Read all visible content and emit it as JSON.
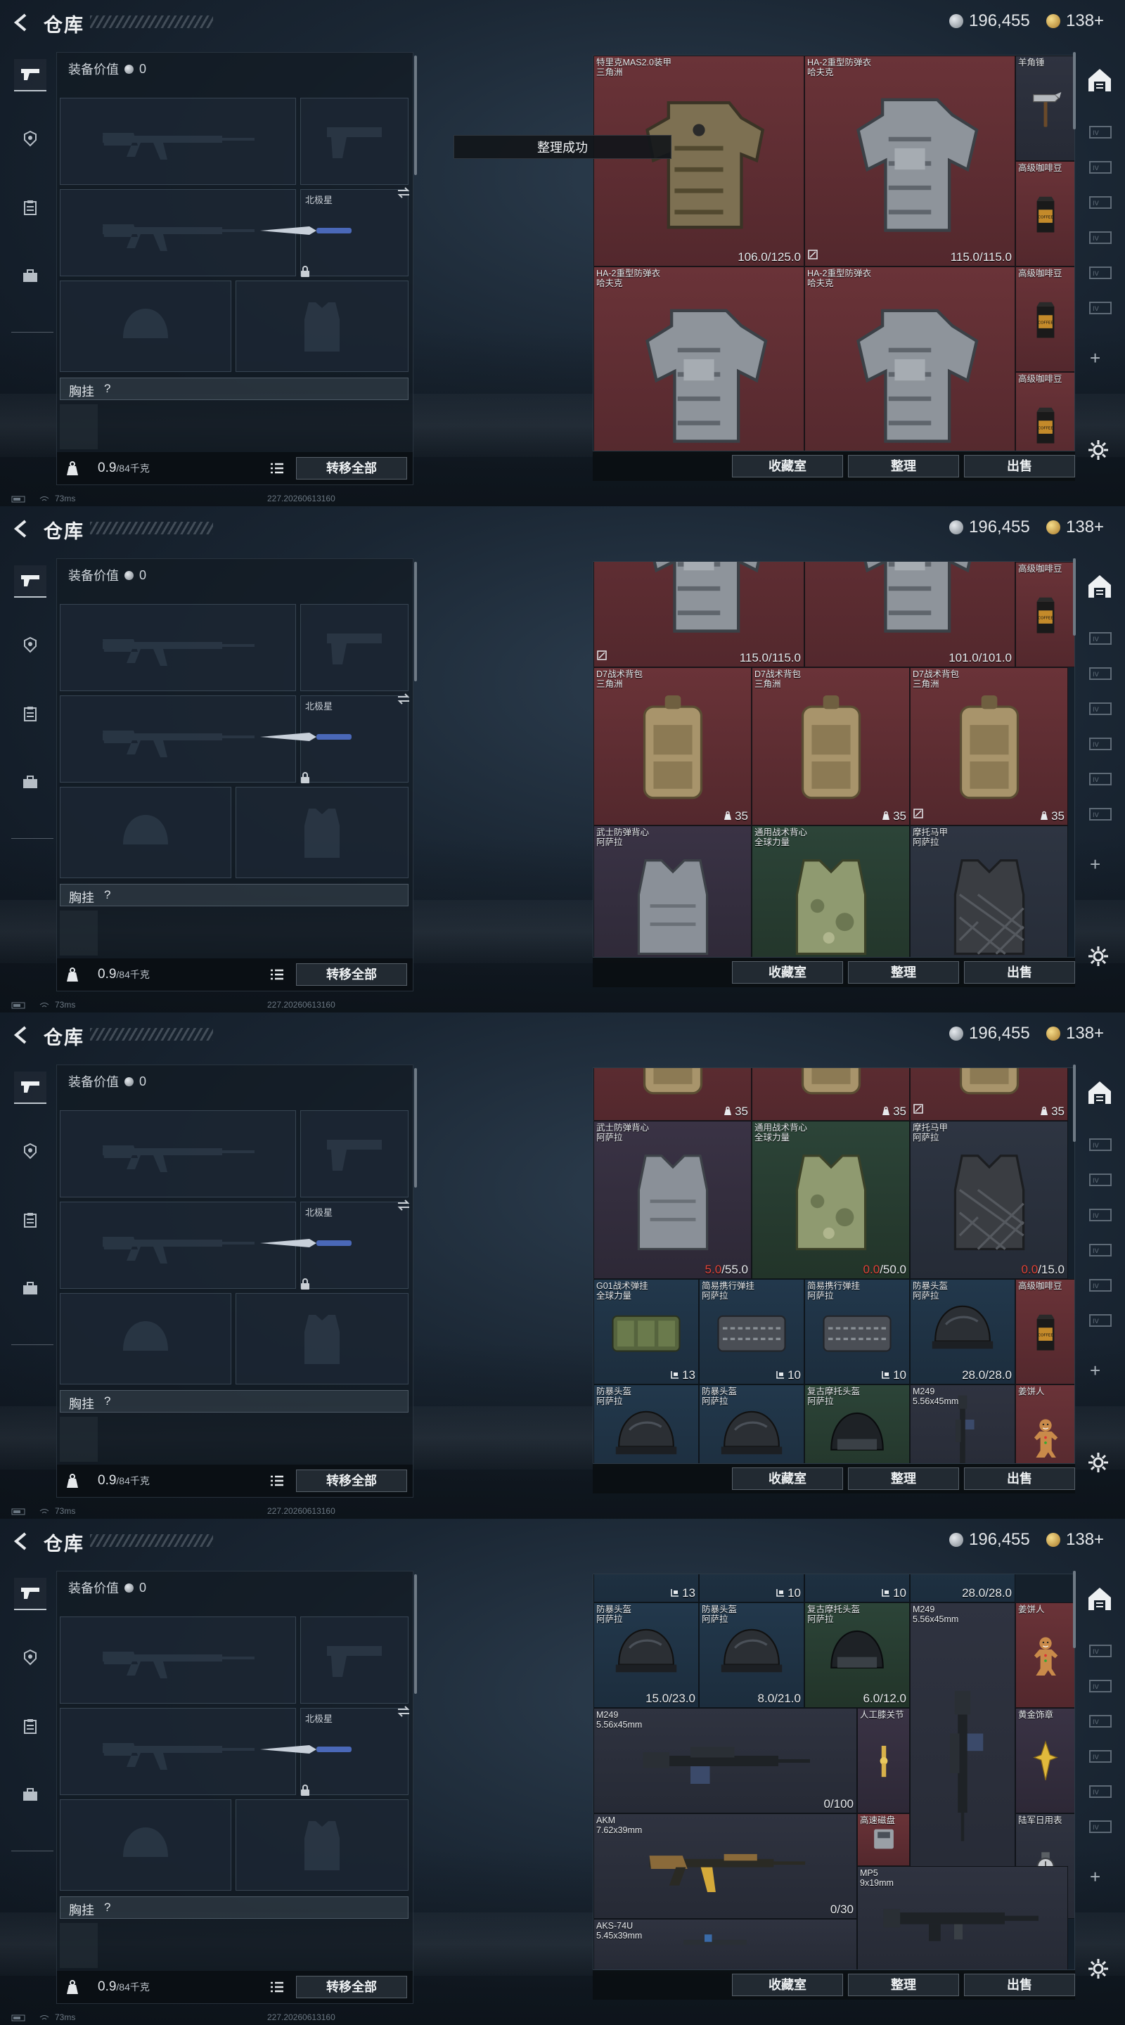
{
  "header": {
    "title": "仓库",
    "silver_amount": "196,455",
    "gold_amount": "138+"
  },
  "equipment": {
    "value_label": "装备价值",
    "value": "0",
    "secondary_weapon_label": "北极星",
    "chest_rig_label": "胸挂",
    "chest_rig_help": "?",
    "weight_current": "0.9",
    "weight_max": "/84千克",
    "transfer_all_label": "转移全部"
  },
  "stash_buttons": {
    "collection_label": "收藏室",
    "sort_label": "整理",
    "sell_label": "出售"
  },
  "toast": "整理成功",
  "status": {
    "ping": "73ms",
    "build": "227.20260613160"
  },
  "stash_items": [
    {
      "name": "特里克MAS2.0装甲",
      "sub": "三角洲",
      "value": "106.0/125.0",
      "color": "red",
      "art": "armor-tan"
    },
    {
      "name": "HA-2重型防弹衣",
      "sub": "哈夫克",
      "value": "115.0/115.0",
      "color": "red",
      "art": "armor-gray",
      "icon": "repair"
    },
    {
      "name": "羊角锤",
      "sub": "",
      "value": "",
      "color": "dark",
      "art": "hammer"
    },
    {
      "name": "高级咖啡豆",
      "sub": "",
      "value": "",
      "color": "red",
      "art": "coffee"
    },
    {
      "name": "HA-2重型防弹衣",
      "sub": "哈夫克",
      "value": "115.0/115.0",
      "color": "red",
      "art": "armor-gray",
      "icon": "repair"
    },
    {
      "name": "HA-2重型防弹衣",
      "sub": "哈夫克",
      "value": "101.0/101.0",
      "color": "red",
      "art": "armor-gray"
    },
    {
      "name": "高级咖啡豆",
      "sub": "",
      "value": "",
      "color": "red",
      "art": "coffee"
    },
    {
      "name": "高级咖啡豆",
      "sub": "",
      "value": "",
      "color": "red",
      "art": "coffee"
    },
    {
      "name": "D7战术背包",
      "sub": "三角洲",
      "value": "35",
      "color": "red",
      "art": "backpack",
      "valicon": "weight"
    },
    {
      "name": "D7战术背包",
      "sub": "三角洲",
      "value": "35",
      "color": "red",
      "art": "backpack",
      "valicon": "weight"
    },
    {
      "name": "D7战术背包",
      "sub": "三角洲",
      "value": "35",
      "color": "red",
      "art": "backpack",
      "valicon": "weight",
      "icon": "repair"
    },
    {
      "name": "高级咖啡豆",
      "sub": "",
      "value": "",
      "color": "red",
      "art": "coffee"
    },
    {
      "name": "武士防弹背心",
      "sub": "阿萨拉",
      "value_low": "5.0",
      "value": "/55.0",
      "color": "purple",
      "art": "vest-gray"
    },
    {
      "name": "通用战术背心",
      "sub": "全球力量",
      "value_low": "0.0",
      "value": "/50.0",
      "color": "green",
      "art": "vest-camo"
    },
    {
      "name": "摩托马甲",
      "sub": "阿萨拉",
      "value_low": "0.0",
      "value": "/15.0",
      "color": "slate",
      "art": "vest-quilt"
    },
    {
      "name": "G01战术弹挂",
      "sub": "全球力量",
      "value": "13",
      "color": "blue",
      "art": "rig-green",
      "valicon": "slots"
    },
    {
      "name": "简易携行弹挂",
      "sub": "阿萨拉",
      "value": "10",
      "color": "blue",
      "art": "rig-gray",
      "valicon": "slots"
    },
    {
      "name": "简易携行弹挂",
      "sub": "阿萨拉",
      "value": "10",
      "color": "blue",
      "art": "rig-gray",
      "valicon": "slots"
    },
    {
      "name": "防暴头盔",
      "sub": "阿萨拉",
      "value": "28.0/28.0",
      "color": "blue",
      "art": "helmet"
    },
    {
      "name": "高级咖啡豆",
      "sub": "",
      "value": "",
      "color": "red",
      "art": "coffee"
    },
    {
      "name": "防暴头盔",
      "sub": "阿萨拉",
      "value": "15.0/23.0",
      "color": "blue",
      "art": "helmet"
    },
    {
      "name": "防暴头盔",
      "sub": "阿萨拉",
      "value": "8.0/21.0",
      "color": "blue",
      "art": "helmet"
    },
    {
      "name": "复古摩托头盔",
      "sub": "阿萨拉",
      "value": "6.0/12.0",
      "color": "green",
      "art": "helmet-moto"
    },
    {
      "name": "M249",
      "sub": "5.56x45mm",
      "value": "0/100",
      "color": "dark",
      "art": "m249-v"
    },
    {
      "name": "姜饼人",
      "sub": "",
      "value": "",
      "color": "red",
      "art": "gingerbread"
    },
    {
      "name": "M249",
      "sub": "5.56x45mm",
      "value": "0/100",
      "color": "dark",
      "art": "m249-h"
    },
    {
      "name": "人工膝关节",
      "sub": "",
      "value": "",
      "color": "purple",
      "art": "knee"
    },
    {
      "name": "黄金饰章",
      "sub": "",
      "value": "",
      "color": "purple",
      "art": "emblem"
    },
    {
      "name": "AKM",
      "sub": "7.62x39mm",
      "value": "0/30",
      "color": "dark",
      "art": "akm"
    },
    {
      "name": "高速磁盘",
      "sub": "",
      "value": "",
      "color": "red",
      "art": "disk"
    },
    {
      "name": "MP5",
      "sub": "9x19mm",
      "value": "",
      "color": "dark",
      "art": "mp5"
    },
    {
      "name": "陆军日用表",
      "sub": "",
      "value": "",
      "color": "dark",
      "art": "watch"
    },
    {
      "name": "AKS-74U",
      "sub": "5.45x39mm",
      "value": "",
      "color": "dark",
      "art": "aks"
    }
  ]
}
